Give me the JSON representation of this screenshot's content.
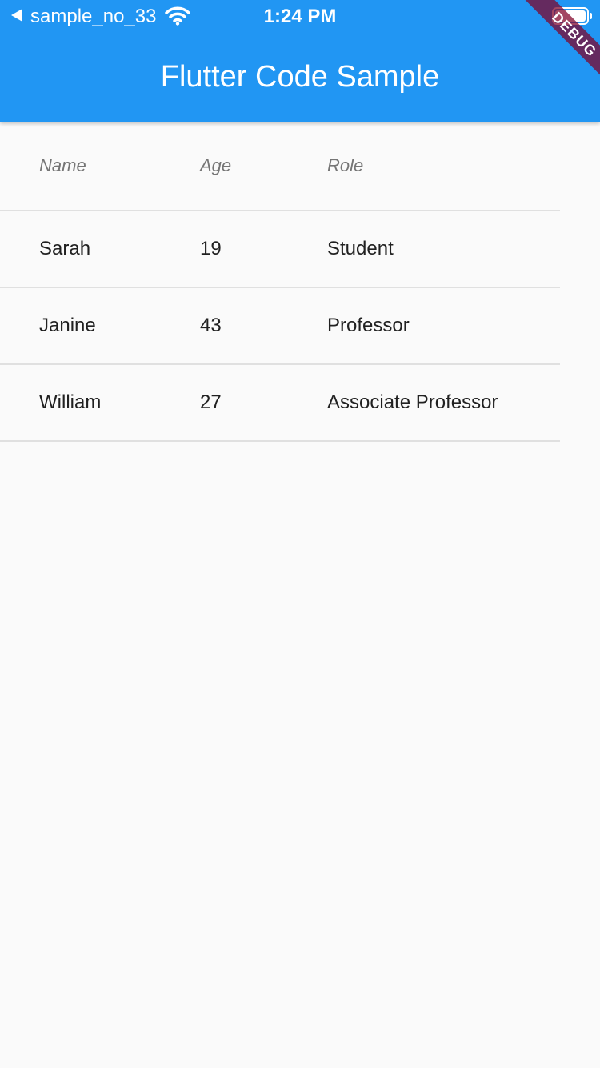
{
  "status_bar": {
    "back_app": "sample_no_33",
    "time": "1:24 PM",
    "icons": [
      "back-arrow-icon",
      "wifi-icon",
      "battery-icon"
    ]
  },
  "app_bar": {
    "title": "Flutter Code Sample",
    "color": "#2196f3"
  },
  "debug_banner": "DEBUG",
  "table": {
    "columns": [
      "Name",
      "Age",
      "Role"
    ],
    "rows": [
      [
        "Sarah",
        "19",
        "Student"
      ],
      [
        "Janine",
        "43",
        "Professor"
      ],
      [
        "William",
        "27",
        "Associate Professor"
      ]
    ]
  }
}
